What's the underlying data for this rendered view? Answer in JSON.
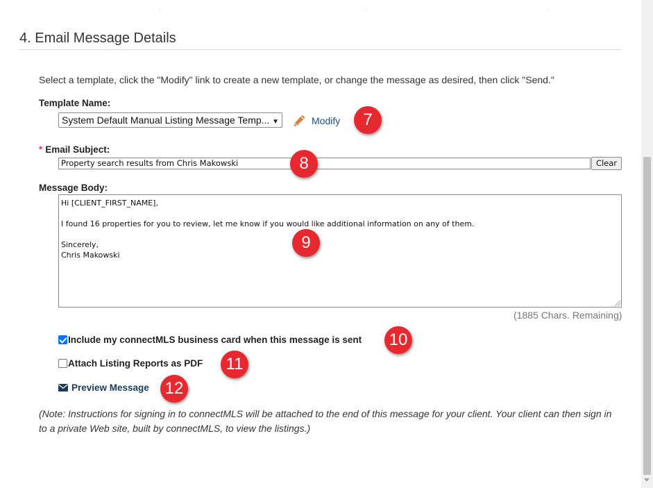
{
  "section": {
    "title": "4. Email Message Details",
    "instructions": "Select a template, click the \"Modify\" link to create a new template, or change the message as desired, then click \"Send.\""
  },
  "template": {
    "label": "Template Name:",
    "selected": "System Default Manual Listing Message Temp...",
    "modify_label": "Modify",
    "icon": "pencil-icon"
  },
  "subject": {
    "required_marker": "*",
    "label": "Email Subject:",
    "value": "Property search results from Chris Makowski",
    "clear_label": "Clear"
  },
  "message": {
    "label": "Message Body:",
    "lines": [
      "Hi [CLIENT_FIRST_NAME],",
      "",
      "I found 16 properties for you to review, let me know if you would like additional information on any of them.",
      "",
      "Sincerely,",
      "Chris Makowski"
    ],
    "chars_remaining": "(1885 Chars. Remaining)"
  },
  "options": {
    "business_card_label": "Include my connectMLS business card when this message is sent",
    "business_card_checked": true,
    "attach_pdf_label": "Attach Listing Reports as PDF",
    "attach_pdf_checked": false
  },
  "preview": {
    "label": "Preview Message",
    "icon": "envelope-icon"
  },
  "note": "(Note: Instructions for signing in to connectMLS will be attached to the end of this message for your client. Your client can then sign in to a private Web site, built by connectMLS, to view the listings.)",
  "badges": [
    "7",
    "8",
    "9",
    "10",
    "11",
    "12"
  ],
  "colors": {
    "badge": "#e8282f",
    "link": "#1b4f7a",
    "checkbox_checked": "#0075ff",
    "pencil": "#d9823b",
    "required": "#d0021b"
  }
}
